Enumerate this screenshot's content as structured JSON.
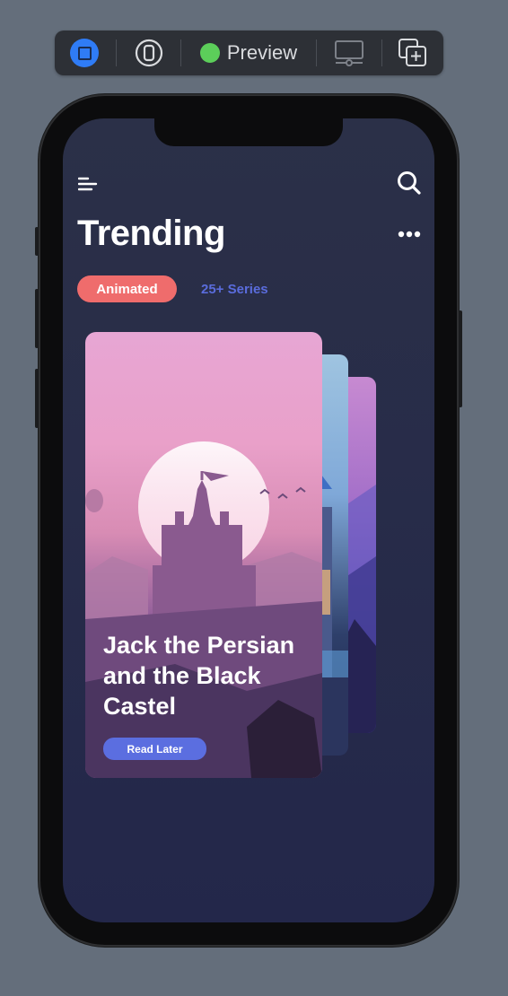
{
  "toolbar": {
    "preview_label": "Preview",
    "icons": [
      "live-preview-icon",
      "device-icon",
      "status-dot-icon",
      "device-settings-icon",
      "duplicate-preview-icon"
    ]
  },
  "app": {
    "title": "Trending",
    "filters": [
      {
        "label": "Animated",
        "selected": true
      },
      {
        "label": "25+ Series",
        "selected": false
      }
    ],
    "featured_card": {
      "title_lines": [
        "Jack the Persian",
        "and the Black",
        "Castel"
      ],
      "action_label": "Read Later"
    }
  },
  "colors": {
    "background": "#646e7b",
    "screen_bg": "#2b3048",
    "accent_red": "#ef6c6c",
    "accent_blue": "#5b6ee0",
    "preview_dot": "#5cce5a",
    "live_button": "#2f7cf6"
  }
}
